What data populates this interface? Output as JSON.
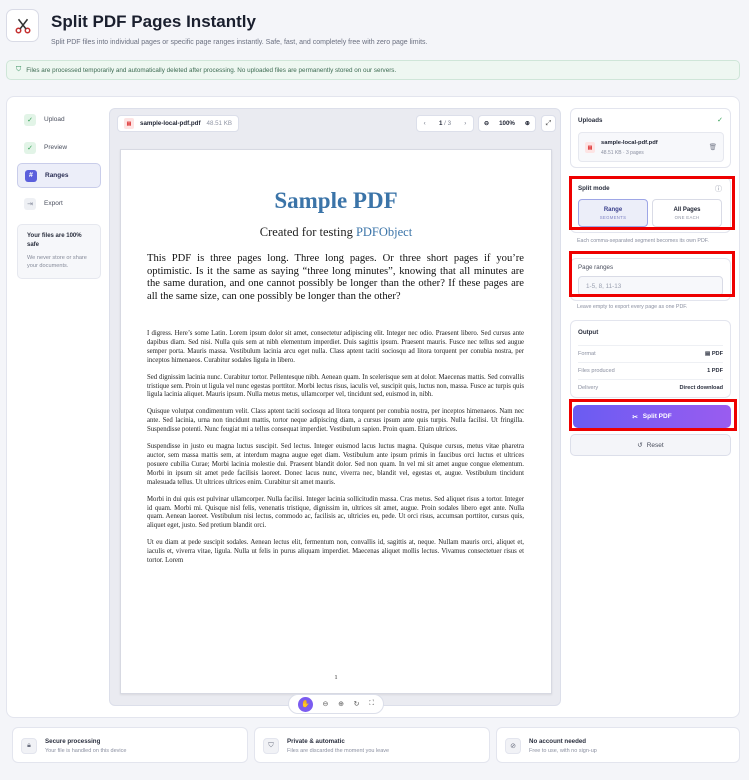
{
  "header": {
    "title": "Split PDF Pages Instantly",
    "subtitle": "Split PDF files into individual pages or specific page ranges instantly. Safe, fast, and completely free with zero page limits."
  },
  "notice": "Files are processed temporarily and automatically deleted after processing. No uploaded files are permanently stored on our servers.",
  "steps": [
    {
      "label": "Upload",
      "state": "done",
      "icon": "check-icon"
    },
    {
      "label": "Preview",
      "state": "done",
      "icon": "check-icon"
    },
    {
      "label": "Ranges",
      "state": "current",
      "icon": "grid-icon"
    },
    {
      "label": "Export",
      "state": "todo",
      "icon": "export-icon"
    }
  ],
  "safe_box": {
    "title": "Your files are 100% safe",
    "text": "We never store or share your documents."
  },
  "viewer": {
    "file_name": "sample-local-pdf.pdf",
    "file_size": "48.51 KB",
    "current_page": "1",
    "page_sep": "/",
    "total_pages": "3",
    "zoom": "100%"
  },
  "pdf": {
    "title": "Sample PDF",
    "subtitle_prefix": "Created for testing ",
    "subtitle_link": "PDFObject",
    "intro": "This PDF is three pages long. Three long pages. Or three short pages if you’re optimistic. Is it the same as saying “three long minutes”, knowing that all minutes are the same duration, and one cannot possibly be longer than the other? If these pages are all the same size, can one possibly be longer than the other?",
    "paragraphs": [
      "I digress. Here’s some Latin. Lorem ipsum dolor sit amet, consectetur adipiscing elit. Integer nec odio. Praesent libero. Sed cursus ante dapibus diam. Sed nisi. Nulla quis sem at nibh elementum imperdiet. Duis sagittis ipsum. Praesent mauris. Fusce nec tellus sed augue semper porta. Mauris massa. Vestibulum lacinia arcu eget nulla. Class aptent taciti sociosqu ad litora torquent per conubia nostra, per inceptos himenaeos. Curabitur sodales ligula in libero.",
      "Sed dignissim lacinia nunc. Curabitur tortor. Pellentesque nibh. Aenean quam. In scelerisque sem at dolor. Maecenas mattis. Sed convallis tristique sem. Proin ut ligula vel nunc egestas porttitor. Morbi lectus risus, iaculis vel, suscipit quis, luctus non, massa. Fusce ac turpis quis ligula lacinia aliquet. Mauris ipsum. Nulla metus metus, ullamcorper vel, tincidunt sed, euismod in, nibh.",
      "Quisque volutpat condimentum velit. Class aptent taciti sociosqu ad litora torquent per conubia nostra, per inceptos himenaeos. Nam nec ante. Sed lacinia, urna non tincidunt mattis, tortor neque adipiscing diam, a cursus ipsum ante quis turpis. Nulla facilisi. Ut fringilla. Suspendisse potenti. Nunc feugiat mi a tellus consequat imperdiet. Vestibulum sapien. Proin quam. Etiam ultrices.",
      "Suspendisse in justo eu magna luctus suscipit. Sed lectus. Integer euismod lacus luctus magna. Quisque cursus, metus vitae pharetra auctor, sem massa mattis sem, at interdum magna augue eget diam. Vestibulum ante ipsum primis in faucibus orci luctus et ultrices posuere cubilia Curae; Morbi lacinia molestie dui. Praesent blandit dolor. Sed non quam. In vel mi sit amet augue congue elementum. Morbi in ipsum sit amet pede facilisis laoreet. Donec lacus nunc, viverra nec, blandit vel, egestas et, augue. Vestibulum tincidunt malesuada tellus. Ut ultrices ultrices enim. Curabitur sit amet mauris.",
      "Morbi in dui quis est pulvinar ullamcorper. Nulla facilisi. Integer lacinia sollicitudin massa. Cras metus. Sed aliquet risus a tortor. Integer id quam. Morbi mi. Quisque nisl felis, venenatis tristique, dignissim in, ultrices sit amet, augue. Proin sodales libero eget ante. Nulla quam. Aenean laoreet. Vestibulum nisi lectus, commodo ac, facilisis ac, ultricies eu, pede. Ut orci risus, accumsan porttitor, cursus quis, aliquet eget, justo. Sed pretium blandit orci.",
      "Ut eu diam at pede suscipit sodales. Aenean lectus elit, fermentum non, convallis id, sagittis at, neque. Nullam mauris orci, aliquet et, iaculis et, viverra vitae, ligula. Nulla ut felis in purus aliquam imperdiet. Maecenas aliquet mollis lectus. Vivamus consectetuer risus et tortor. Lorem"
    ],
    "page_number": "1"
  },
  "uploads": {
    "title": "Uploads",
    "file_name": "sample-local-pdf.pdf",
    "file_meta": "48.51 KB · 3 pages"
  },
  "split_mode": {
    "title": "Split mode",
    "range_label": "Range",
    "range_sub": "SEGMENTS",
    "all_label": "All Pages",
    "all_sub": "ONE EACH",
    "help": "Each comma-separated segment becomes its own PDF."
  },
  "page_ranges": {
    "label": "Page ranges",
    "value": "",
    "placeholder": "1-5, 8, 11-13",
    "help": "Leave empty to export every page as one PDF."
  },
  "output": {
    "title": "Output",
    "rows": [
      {
        "key": "Format",
        "value": "PDF"
      },
      {
        "key": "Files produced",
        "value": "1 PDF"
      },
      {
        "key": "Delivery",
        "value": "Direct download"
      }
    ]
  },
  "actions": {
    "split": "Split PDF",
    "reset": "Reset"
  },
  "features": [
    {
      "title": "Secure processing",
      "desc": "Your file is handled on this device",
      "icon": "lock-icon"
    },
    {
      "title": "Private & automatic",
      "desc": "Files are discarded the moment you leave",
      "icon": "shield-icon"
    },
    {
      "title": "No account needed",
      "desc": "Free to use, with no sign-up",
      "icon": "no-account-icon"
    }
  ],
  "colors": {
    "accent": "#6a5cf2",
    "annotation": "#ee0000",
    "pdf_title": "#3b74a8"
  }
}
